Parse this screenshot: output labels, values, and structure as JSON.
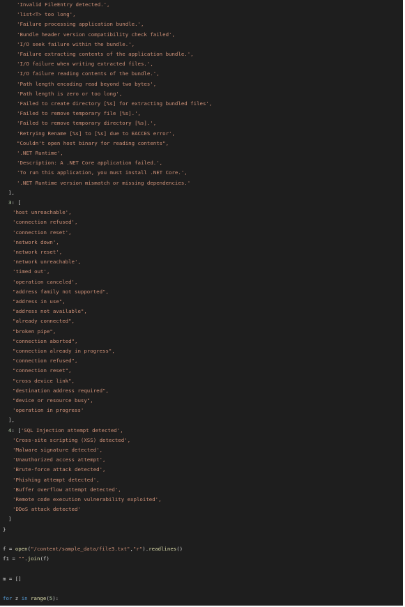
{
  "code": {
    "group2_strings": [
      "'Invalid FileEntry detected.',",
      "'list<T> too long',",
      "'Failure processing application bundle.',",
      "'Bundle header version compatibility check failed',",
      "'I/O seek failure within the bundle.',",
      "'Failure extracting contents of the application bundle.',",
      "'I/O failure when writing extracted files.',",
      "'I/O failure reading contents of the bundle.',",
      "'Path length encoding read beyond two bytes',",
      "'Path length is zero or too long',",
      "'Failed to create directory [%s] for extracting bundled files',",
      "'Failed to remove temporary file [%s].',",
      "'Failed to remove temporary directory [%s].',",
      "'Retrying Rename [%s] to [%s] due to EACCES error',",
      "\"Couldn't open host binary for reading contents\",",
      "'.NET Runtime',",
      "'Description: A .NET Core application failed.',",
      "'To run this application, you must install .NET Core.',",
      "'.NET Runtime version mismatch or missing dependencies.'"
    ],
    "group2_close": "],",
    "group3_key": "3",
    "group3_open": ": [",
    "group3_strings": [
      "'host unreachable',",
      "'connection refused',",
      "'connection reset',",
      "'network down',",
      "'network reset',",
      "'network unreachable',",
      "'timed out',",
      "'operation canceled',",
      "\"address family not supported\",",
      "\"address in use\",",
      "\"address not available\",",
      "\"already connected\",",
      "\"broken pipe\",",
      "\"connection aborted\",",
      "\"connection already in progress\",",
      "\"connection refused\",",
      "\"connection reset\",",
      "\"cross device link\",",
      "\"destination address required\",",
      "\"device or resource busy\",",
      "'operation in progress'"
    ],
    "group3_close": "],",
    "group4_key": "4",
    "group4_open": ": [",
    "group4_first": "'SQL Injection attempt detected',",
    "group4_strings": [
      "'Cross-site scripting (XSS) detected',",
      "'Malware signature detected',",
      "'Unauthorized access attempt',",
      "'Brute-force attack detected',",
      "'Phishing attempt detected',",
      "'Buffer overflow attempt detected',",
      "'Remote code execution vulnerability exploited',",
      "'DDoS attack detected'"
    ],
    "group4_close": "]",
    "dict_close": "}",
    "line_f_var": "f",
    "line_f_eq": " = ",
    "line_f_fn": "open",
    "line_f_paren1": "(",
    "line_f_path": "\"/content/sample_data/file3.txt\"",
    "line_f_comma": ",",
    "line_f_mode": "\"r\"",
    "line_f_paren2": ").",
    "line_f_method": "readlines",
    "line_f_end": "()",
    "line_f1_var": "f1",
    "line_f1_eq": " = ",
    "line_f1_str": "\"\"",
    "line_f1_dot": ".",
    "line_f1_fn": "join",
    "line_f1_end": "(f)",
    "line_m": "m = []",
    "line_for_kw": "for",
    "line_for_var": " z ",
    "line_for_in": "in",
    "line_for_space": " ",
    "line_for_fn": "range",
    "line_for_p1": "(",
    "line_for_num": "5",
    "line_for_end": "):"
  }
}
